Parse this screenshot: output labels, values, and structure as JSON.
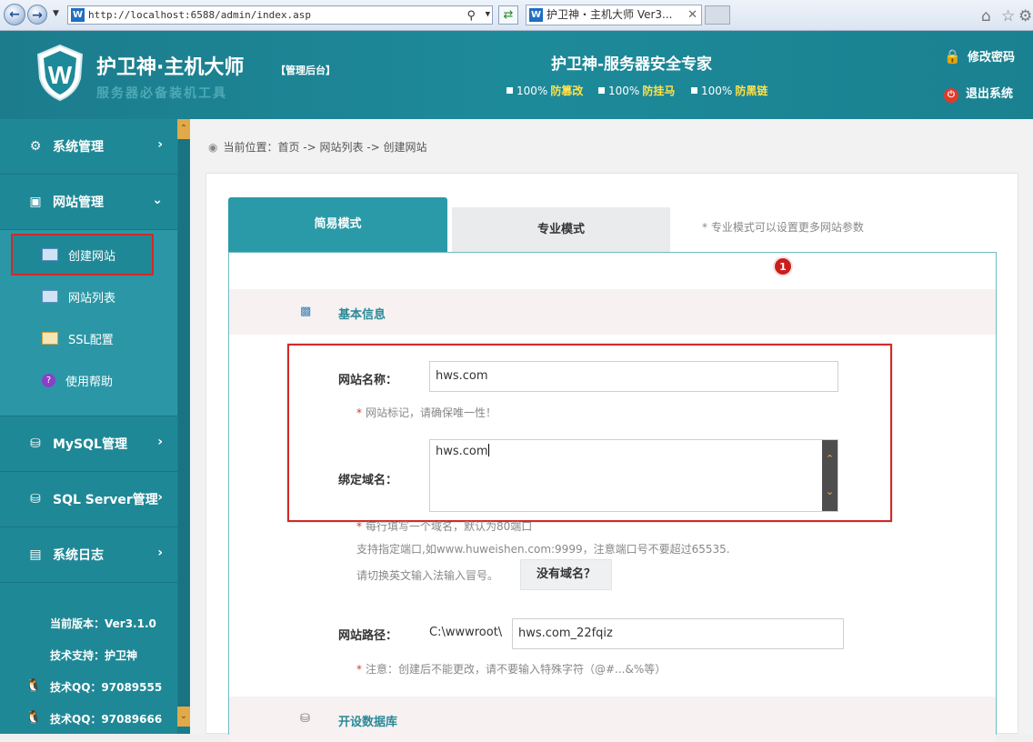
{
  "browser": {
    "url": "http://localhost:6588/admin/index.asp",
    "tab_title": "护卫神・主机大师 Ver3...",
    "favicon_letter": "W"
  },
  "header": {
    "brand_title": "护卫神·主机大师",
    "brand_badge": "【管理后台】",
    "brand_subtitle": "服务器必备装机工具",
    "center_title": "护卫神-服务器安全专家",
    "stats": [
      {
        "value": "100%",
        "label": "防篡改"
      },
      {
        "value": "100%",
        "label": "防挂马"
      },
      {
        "value": "100%",
        "label": "防黑链"
      }
    ],
    "change_password": "修改密码",
    "logout": "退出系统"
  },
  "sidebar": {
    "menu": [
      {
        "label": "系统管理"
      },
      {
        "label": "网站管理"
      },
      {
        "label": "MySQL管理"
      },
      {
        "label": "SQL Server管理"
      },
      {
        "label": "系统日志"
      }
    ],
    "submenu": [
      {
        "label": "创建网站"
      },
      {
        "label": "网站列表"
      },
      {
        "label": "SSL配置"
      },
      {
        "label": "使用帮助"
      }
    ],
    "version": "当前版本：Ver3.1.0",
    "support": "技术支持：护卫神",
    "qq1": "技术QQ：97089555",
    "qq2": "技术QQ：97089666"
  },
  "main": {
    "breadcrumb": "当前位置：首页 -> 网站列表 -> 创建网站",
    "tabs": {
      "simple": "简易模式",
      "pro": "专业模式",
      "hint": "* 专业模式可以设置更多网站参数"
    },
    "step_badge": "1",
    "section_basic": "基本信息",
    "section_db": "开设数据库",
    "form": {
      "site_name_label": "网站名称：",
      "site_name_value": "hws.com",
      "site_name_hint": "网站标记，请确保唯一性！",
      "domain_label": "绑定域名：",
      "domain_value": "hws.com",
      "domain_hint1": "每行填写一个域名，默认为80端口",
      "domain_hint2": "支持指定端口,如www.huweishen.com:9999，注意端口号不要超过65535.",
      "domain_hint3": "请切换英文输入法输入冒号。",
      "no_domain_button": "没有域名？",
      "path_label": "网站路径：",
      "path_prefix": "C:\\wwwroot\\",
      "path_value": "hws.com_22fqiz",
      "path_hint": "注意：创建后不能更改，请不要输入特殊字符（@#...&%等）"
    }
  }
}
